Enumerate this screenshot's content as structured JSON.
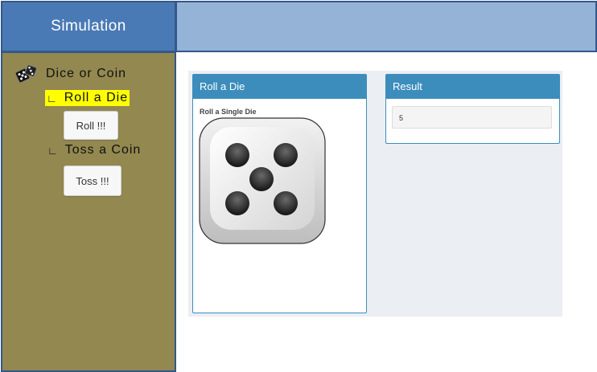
{
  "header": {
    "title": "Simulation"
  },
  "sidebar": {
    "menu_label": "Dice  or  Coin",
    "items": [
      {
        "corner": "∟",
        "label": "Roll  a  Die",
        "button": "Roll !!!",
        "active": true
      },
      {
        "corner": "∟",
        "label": "Toss  a  Coin",
        "button": "Toss !!!",
        "active": false
      }
    ],
    "highlight_color": "#ffff00"
  },
  "main": {
    "die_panel": {
      "title": "Roll a Die",
      "caption": "Roll a Single Die",
      "die_face": 5
    },
    "result_panel": {
      "title": "Result",
      "value": "5"
    }
  },
  "colors": {
    "header": "#4a7ab5",
    "sidebar": "#928850",
    "panel_accent": "#3c8dbc"
  }
}
